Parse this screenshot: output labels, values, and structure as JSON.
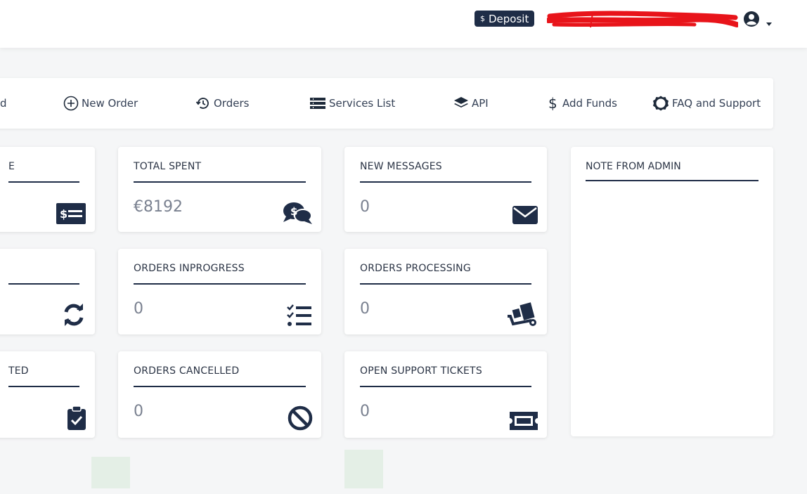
{
  "header": {
    "deposit_currency": "$",
    "deposit_label": "Deposit",
    "user_icon": "user-circle-icon",
    "redaction_color": "#e8141a"
  },
  "nav": {
    "items": [
      {
        "label": "d",
        "icon": "dashboard-icon"
      },
      {
        "label": "New Order",
        "icon": "plus-circle-icon"
      },
      {
        "label": "Orders",
        "icon": "history-icon"
      },
      {
        "label": "Services List",
        "icon": "list-icon"
      },
      {
        "label": "API",
        "icon": "layers-icon"
      },
      {
        "label": "Add Funds",
        "icon": "dollar-icon"
      },
      {
        "label": "FAQ and Support",
        "icon": "gear-icon"
      }
    ]
  },
  "stats": {
    "balance": {
      "title": "E",
      "value": "",
      "icon": "money-bill-icon"
    },
    "total_spent": {
      "title": "TOTAL SPENT",
      "value": "€8192",
      "icon": "comments-dollar-icon"
    },
    "new_messages": {
      "title": "NEW MESSAGES",
      "value": "0",
      "icon": "envelope-icon"
    },
    "refills": {
      "title": "",
      "value": "",
      "icon": "refresh-icon"
    },
    "orders_inprogress": {
      "title": "ORDERS INPROGRESS",
      "value": "0",
      "icon": "tasks-icon"
    },
    "orders_processing": {
      "title": "ORDERS PROCESSING",
      "value": "0",
      "icon": "dolly-icon"
    },
    "completed": {
      "title": "TED",
      "value": "",
      "icon": "clipboard-check-icon"
    },
    "orders_cancelled": {
      "title": "ORDERS CANCELLED",
      "value": "0",
      "icon": "ban-icon"
    },
    "open_tickets": {
      "title": "OPEN SUPPORT TICKETS",
      "value": "0",
      "icon": "ticket-icon"
    }
  },
  "admin_note": {
    "title": "NOTE FROM ADMIN",
    "body": ""
  },
  "colors": {
    "accent": "#1f2d47",
    "background": "#f5f6f7",
    "card": "#ffffff"
  }
}
